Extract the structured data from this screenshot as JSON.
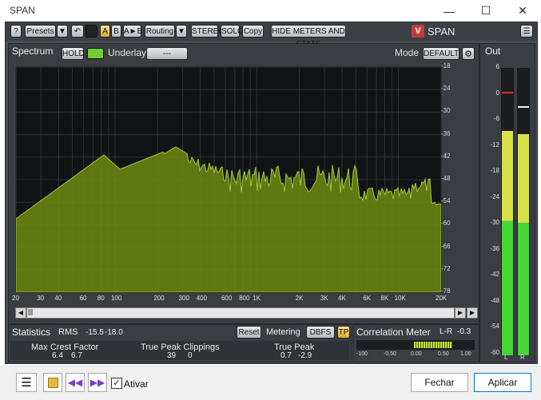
{
  "window": {
    "title": "SPAN",
    "minimize": "—",
    "maximize": "☐",
    "close": "✕"
  },
  "toolbar": {
    "help": "?",
    "presets": "Presets",
    "presets_arrow": "▼",
    "undo": "↶",
    "ab_a": "A",
    "ab_b": "B",
    "ab_copy": "A►B",
    "routing": "Routing",
    "routing_arrow": "▼",
    "stereo": "STEREO",
    "solo": "SOLO",
    "copy": "Copy",
    "hide_meters": "HIDE METERS AND STATS",
    "logo_text": "SPAN",
    "menu": "☰"
  },
  "spectrum": {
    "tab": "Spectrum",
    "hold": "HOLD",
    "underlay_label": "Underlay",
    "underlay_value": "---",
    "mode_label": "Mode",
    "mode_value": "DEFAULT",
    "db_ticks": [
      "-18",
      "-24",
      "-30",
      "-36",
      "-42",
      "-48",
      "-54",
      "-60",
      "-66",
      "-72",
      "-78"
    ],
    "freq_ticks": [
      "20",
      "30",
      "40",
      "60",
      "80",
      "100",
      "200",
      "300",
      "400",
      "600",
      "800",
      "1K",
      "2K",
      "3K",
      "4K",
      "6K",
      "8K",
      "10K",
      "20K"
    ],
    "fill_color": "#6f8a12",
    "line_color": "#a7c93a"
  },
  "out": {
    "tab": "Out",
    "scale": [
      "6",
      "0",
      "-6",
      "-12",
      "-18",
      "-24",
      "-30",
      "-36",
      "-42",
      "-48",
      "-54",
      "-60"
    ],
    "left_label": "L",
    "right_label": "R",
    "left_level": 0.78,
    "right_level": 0.77
  },
  "stats": {
    "tab": "Statistics",
    "rms_label": "RMS",
    "rms_left": "-15.5",
    "rms_right": "-18.0",
    "reset": "Reset",
    "metering_label": "Metering",
    "metering_value": "DBFS",
    "tp": "TP",
    "crest_label": "Max Crest Factor",
    "crest_left": "6.4",
    "crest_right": "6.7",
    "tpc_label": "True Peak Clippings",
    "tpc_left": "39",
    "tpc_right": "0",
    "tp_label": "True Peak",
    "tp_left": "0.7",
    "tp_right": "-2.9"
  },
  "correlation": {
    "title": "Correlation Meter",
    "lr_label": "L-R",
    "lr_value": "-0.3",
    "scale": [
      "-100",
      "-0.50",
      "0.00",
      "0.50",
      "1.00"
    ]
  },
  "footer": {
    "ativar_label": "Ativar",
    "checkmark": "✓",
    "fechar": "Fechar",
    "aplicar": "Aplicar"
  }
}
